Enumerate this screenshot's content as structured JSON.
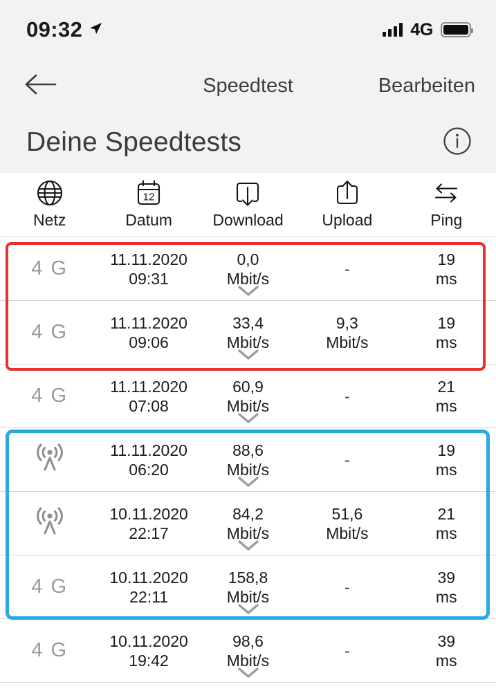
{
  "status_bar": {
    "time": "09:32",
    "location_icon": "location-arrow-icon",
    "signal_icon": "signal-bars-icon",
    "network_type": "4G",
    "battery_icon": "battery-full-icon"
  },
  "nav_bar": {
    "back_icon": "back-arrow-icon",
    "title": "Speedtest",
    "action_label": "Bearbeiten"
  },
  "page_header": {
    "title": "Deine Speedtests",
    "info_icon": "info-circle-icon"
  },
  "table": {
    "columns": [
      {
        "label": "Netz",
        "icon": "globe-icon"
      },
      {
        "label": "Datum",
        "icon": "calendar-icon"
      },
      {
        "label": "Download",
        "icon": "download-icon"
      },
      {
        "label": "Upload",
        "icon": "upload-icon"
      },
      {
        "label": "Ping",
        "icon": "swap-arrows-icon"
      }
    ],
    "calendar_day": "12",
    "expand_icon": "chevron-down-icon",
    "rows": [
      {
        "net": "4 G",
        "net_icon": "4g-label",
        "date": "11.11.2020",
        "time": "09:31",
        "download_value": "0,0",
        "download_unit": "Mbit/s",
        "upload_value": "-",
        "upload_unit": "",
        "ping_value": "19",
        "ping_unit": "ms"
      },
      {
        "net": "4 G",
        "net_icon": "4g-label",
        "date": "11.11.2020",
        "time": "09:06",
        "download_value": "33,4",
        "download_unit": "Mbit/s",
        "upload_value": "9,3",
        "upload_unit": "Mbit/s",
        "ping_value": "19",
        "ping_unit": "ms"
      },
      {
        "net": "4 G",
        "net_icon": "4g-label",
        "date": "11.11.2020",
        "time": "07:08",
        "download_value": "60,9",
        "download_unit": "Mbit/s",
        "upload_value": "-",
        "upload_unit": "",
        "ping_value": "21",
        "ping_unit": "ms"
      },
      {
        "net": "",
        "net_icon": "antenna-icon",
        "date": "11.11.2020",
        "time": "06:20",
        "download_value": "88,6",
        "download_unit": "Mbit/s",
        "upload_value": "-",
        "upload_unit": "",
        "ping_value": "19",
        "ping_unit": "ms"
      },
      {
        "net": "",
        "net_icon": "antenna-icon",
        "date": "10.11.2020",
        "time": "22:17",
        "download_value": "84,2",
        "download_unit": "Mbit/s",
        "upload_value": "51,6",
        "upload_unit": "Mbit/s",
        "ping_value": "21",
        "ping_unit": "ms"
      },
      {
        "net": "4 G",
        "net_icon": "4g-label",
        "date": "10.11.2020",
        "time": "22:11",
        "download_value": "158,8",
        "download_unit": "Mbit/s",
        "upload_value": "-",
        "upload_unit": "",
        "ping_value": "39",
        "ping_unit": "ms"
      },
      {
        "net": "4 G",
        "net_icon": "4g-label",
        "date": "10.11.2020",
        "time": "19:42",
        "download_value": "98,6",
        "download_unit": "Mbit/s",
        "upload_value": "-",
        "upload_unit": "",
        "ping_value": "39",
        "ping_unit": "ms"
      }
    ]
  },
  "annotations": [
    {
      "name": "red-highlight-box",
      "color": "#e8302c",
      "covers_rows": [
        0,
        1
      ]
    },
    {
      "name": "blue-highlight-box",
      "color": "#29a9e1",
      "covers_rows": [
        3,
        4,
        5
      ]
    }
  ],
  "colors": {
    "chrome_background": "#f2f2f2",
    "table_background": "#ffffff",
    "divider": "#d5d5d5",
    "muted_text": "#9a9a9a",
    "primary_text": "#1b1b1b"
  }
}
